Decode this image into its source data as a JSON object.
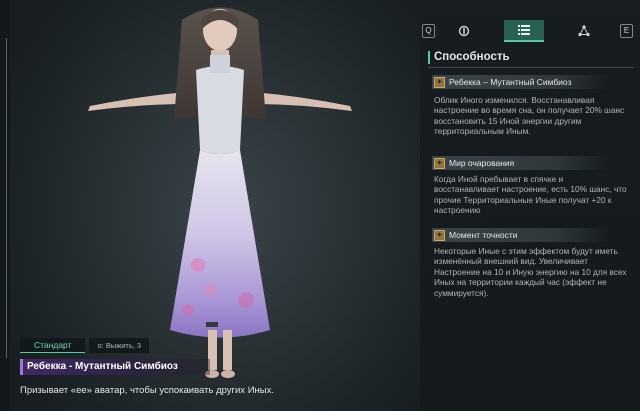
{
  "tabs": {
    "left_key": "Q",
    "right_key": "E",
    "items": [
      {
        "icon": "gear-cog-icon",
        "active": false
      },
      {
        "icon": "list-icon",
        "active": true
      },
      {
        "icon": "network-nodes-icon",
        "active": false
      }
    ]
  },
  "panel": {
    "title": "Способность",
    "abilities": [
      {
        "name": "Ребекка – Мутантный Симбиоз",
        "icon": "ability-badge-icon",
        "description": "Облик Иного изменился. Восстанавливая настроение во время сна, он получает 20% шанс восстановить 15 Иной энергии другим территориальным Иным."
      },
      {
        "name": "Мир очарования",
        "icon": "ability-badge-icon",
        "description": "Когда Иной пребывает в спячке и восстанавливает настроение, есть 10% шанс, что прочие Территориальные Иные получат +20 к настроению"
      },
      {
        "name": "Момент точности",
        "icon": "ability-badge-icon",
        "description": "Некоторые Иные с этим эффектом будут иметь изменённый внешний вид. Увеличивает Настроение на 10 и Иную энергию на 10 для всех Иных на территории каждый час (эффект не суммируется)."
      }
    ]
  },
  "bottom": {
    "tag_standard": "Стандарт",
    "tag_key": "о: Выжить, 3",
    "name": "Ребекка - Мутантный Симбиоз",
    "subtitle": "Призывает «ее» аватар, чтобы успокаивать других Иных."
  },
  "colors": {
    "accent": "#59c7a6",
    "name_bar": "#3e2a63",
    "dress": "#cfc6e6"
  }
}
